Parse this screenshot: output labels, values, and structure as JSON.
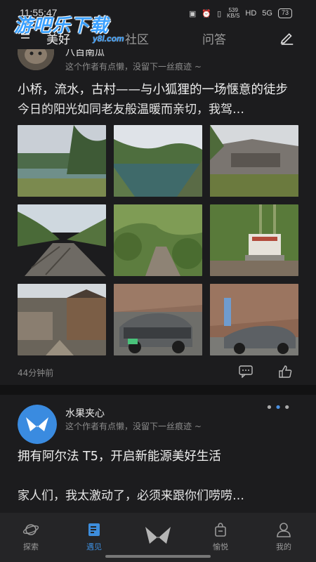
{
  "status_bar": {
    "time": "11:55:47",
    "net_speed": "539",
    "net_unit": "KB/S",
    "signal": "5G",
    "battery": "73"
  },
  "watermark": {
    "main": "游吧乐下载",
    "sub": "y8l.com"
  },
  "top_tabs": [
    {
      "label": "美好",
      "active": true
    },
    {
      "label": "社区",
      "active": false
    },
    {
      "label": "问答",
      "active": false
    }
  ],
  "posts": [
    {
      "author": "八百南瓜",
      "bio": "这个作者有点懒，没留下一丝痕迹 ~",
      "title": "小桥，流水，古村——与小狐狸的一场惬意的徒步",
      "excerpt": "今日的阳光如同老友般温暖而亲切，我驾…",
      "time_ago": "44分钟前"
    },
    {
      "author": "水果夹心",
      "bio": "这个作者有点懒，没留下一丝痕迹 ~",
      "title": "拥有阿尔法 T5，开启新能源美好生活",
      "excerpt": "家人们，我太激动了，必须来跟你们唠唠…"
    }
  ],
  "bottom_nav": [
    {
      "label": "探索",
      "icon": "planet-icon",
      "active": false
    },
    {
      "label": "遇见",
      "icon": "book-icon",
      "active": true
    },
    {
      "label": "",
      "icon": "brand-logo-icon",
      "active": false
    },
    {
      "label": "愉悦",
      "icon": "shopping-bag-icon",
      "active": false
    },
    {
      "label": "我的",
      "icon": "user-icon",
      "active": false
    }
  ],
  "colors": {
    "accent": "#3d8ddc",
    "background": "#1c1c1e",
    "nav_bg": "#252527"
  }
}
